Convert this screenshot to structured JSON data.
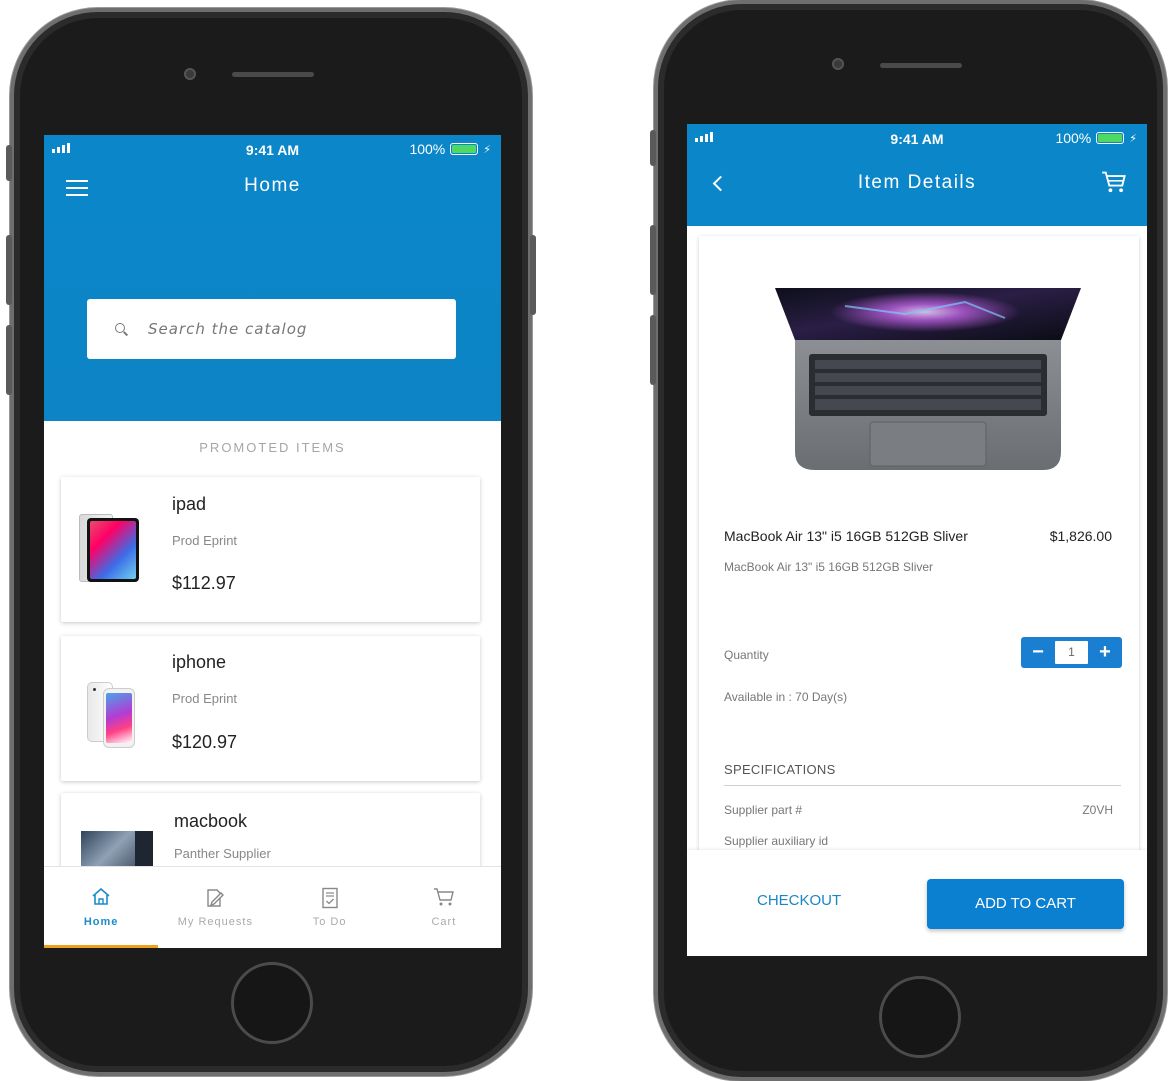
{
  "left_screen": {
    "status": {
      "time": "9:41 AM",
      "battery": "100%"
    },
    "header": {
      "title": "Home"
    },
    "search": {
      "placeholder": "Search the catalog"
    },
    "promoted_label": "PROMOTED ITEMS",
    "items": [
      {
        "name": "ipad",
        "supplier": "Prod Eprint",
        "price": "$112.97"
      },
      {
        "name": "iphone",
        "supplier": "Prod Eprint",
        "price": "$120.97"
      },
      {
        "name": "macbook",
        "supplier": "Panther Supplier"
      }
    ],
    "tabs": [
      {
        "label": "Home",
        "icon": "home-icon",
        "active": true
      },
      {
        "label": "My Requests",
        "icon": "edit-document-icon"
      },
      {
        "label": "To Do",
        "icon": "checklist-icon"
      },
      {
        "label": "Cart",
        "icon": "cart-icon"
      }
    ]
  },
  "right_screen": {
    "status": {
      "time": "9:41 AM",
      "battery": "100%"
    },
    "header": {
      "title": "Item Details"
    },
    "item": {
      "title": "MacBook Air 13\" i5 16GB 512GB  Sliver",
      "price": "$1,826.00",
      "subtitle": "MacBook Air 13\" i5 16GB 512GB  Sliver",
      "quantity_label": "Quantity",
      "quantity": "1",
      "availability": "Available in : 70 Day(s)"
    },
    "specifications": {
      "heading": "SPECIFICATIONS",
      "rows": [
        {
          "label": "Supplier part #",
          "value": "Z0VH"
        },
        {
          "label": "Supplier auxiliary id",
          "value": ""
        }
      ]
    },
    "footer": {
      "checkout": "CHECKOUT",
      "add_to_cart": "ADD TO CART"
    }
  },
  "colors": {
    "primary": "#0b87c9",
    "button": "#0b7fd0",
    "active_tab_underline": "#f0a11c",
    "battery": "#4cd964"
  }
}
